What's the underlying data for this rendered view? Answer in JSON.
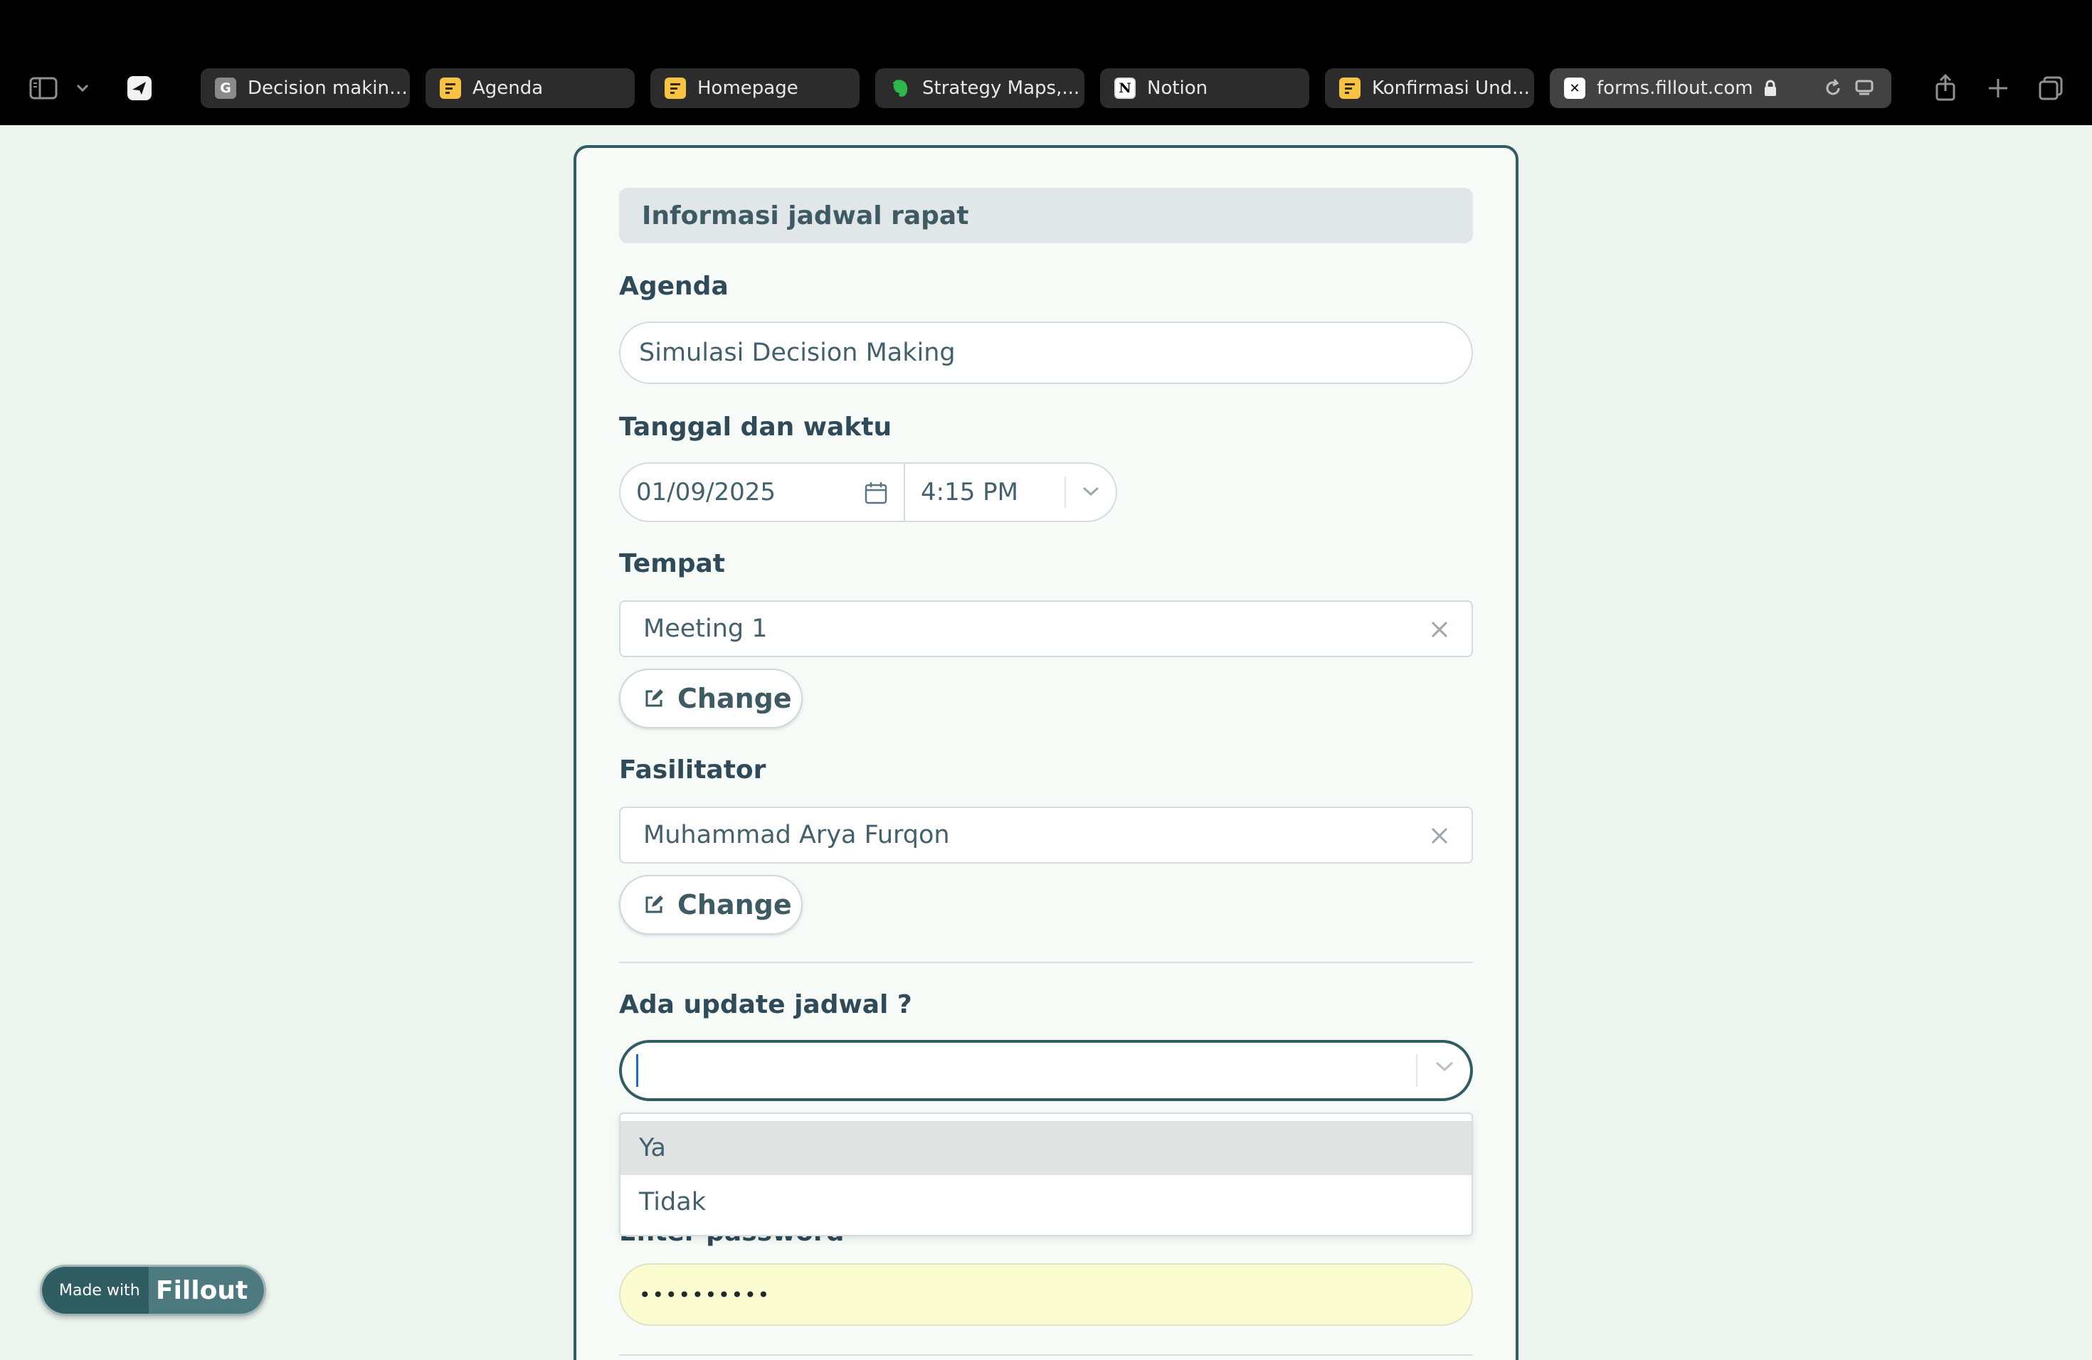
{
  "browser": {
    "tabs": [
      {
        "label": "Decision making...",
        "icon": "google-docs-icon",
        "active": false
      },
      {
        "label": "Agenda",
        "icon": "doc-icon",
        "active": false
      },
      {
        "label": "Homepage",
        "icon": "doc-icon",
        "active": false
      },
      {
        "label": "Strategy Maps,...",
        "icon": "evernote-icon",
        "active": false
      },
      {
        "label": "Notion",
        "icon": "notion-icon",
        "active": false
      },
      {
        "label": "Konfirmasi Und...",
        "icon": "doc-icon",
        "active": false
      },
      {
        "label": "forms.fillout.com",
        "icon": "fillout-icon",
        "active": true
      }
    ],
    "favicon_letters": {
      "g": "G",
      "notion": "N",
      "x": "✕"
    }
  },
  "form": {
    "section_title": "Informasi jadwal rapat",
    "agenda": {
      "label": "Agenda",
      "value": "Simulasi Decision Making"
    },
    "datetime": {
      "label": "Tanggal dan waktu",
      "date": "01/09/2025",
      "time": "4:15 PM"
    },
    "tempat": {
      "label": "Tempat",
      "value": "Meeting 1",
      "change_label": "Change"
    },
    "fasilitator": {
      "label": "Fasilitator",
      "value": "Muhammad Arya Furqon",
      "change_label": "Change"
    },
    "update": {
      "label": "Ada update jadwal ?",
      "value": "",
      "options": [
        "Ya",
        "Tidak"
      ],
      "highlighted": "Ya"
    },
    "password": {
      "label": "Enter password",
      "value": "••••••••••"
    }
  },
  "badge": {
    "made_with": "Made with",
    "brand": "Fillout"
  },
  "colors": {
    "accent": "#2f5d62",
    "page_bg": "#edf6ee",
    "label": "#2f4a58",
    "autofill": "#fbfdd0"
  }
}
